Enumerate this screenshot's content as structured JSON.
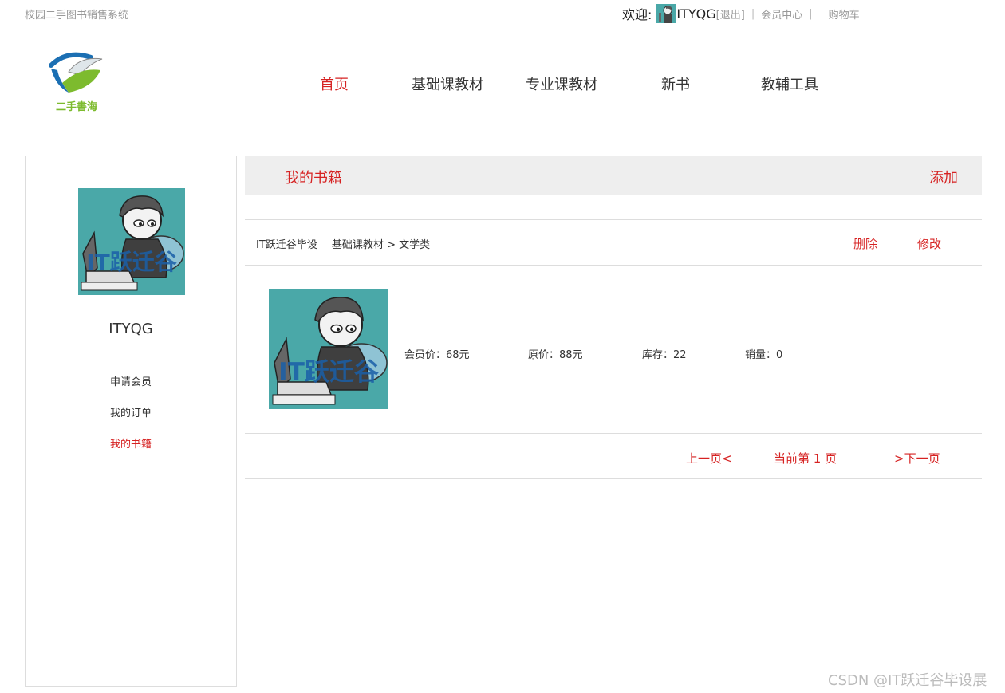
{
  "header": {
    "site_name": "校园二手图书销售系统",
    "welcome": "欢迎:",
    "username": "ITYQG",
    "logout": "[退出]",
    "member_center": "会员中心",
    "cart": "购物车"
  },
  "logo": {
    "text": "二手書海"
  },
  "nav": {
    "items": [
      {
        "label": "首页"
      },
      {
        "label": "基础课教材"
      },
      {
        "label": "专业课教材"
      },
      {
        "label": "新书"
      },
      {
        "label": "教辅工具"
      }
    ],
    "active_index": 0
  },
  "sidebar": {
    "username": "ITYQG",
    "avatar_text": "IT跃迁谷",
    "menu": [
      {
        "label": "申请会员"
      },
      {
        "label": "我的订单"
      },
      {
        "label": "我的书籍"
      }
    ],
    "active_index": 2
  },
  "content": {
    "title": "我的书籍",
    "add_label": "添加"
  },
  "book": {
    "seller": "IT跃迁谷毕设",
    "category": "基础课教材",
    "separator": ">",
    "subcategory": "文学类",
    "delete_label": "删除",
    "edit_label": "修改",
    "cover_text": "IT跃迁谷",
    "member_price": "会员价：68元",
    "original_price": "原价：88元",
    "stock": "库存：22",
    "sales": "销量：0"
  },
  "pager": {
    "prev": "上一页<",
    "current": "当前第 1 页",
    "next": ">下一页"
  },
  "watermark": "CSDN @IT跃迁谷毕设展",
  "colors": {
    "accent": "#d62222",
    "avatar_bg": "#4aa8a8",
    "header_bg": "#eeeeee"
  }
}
